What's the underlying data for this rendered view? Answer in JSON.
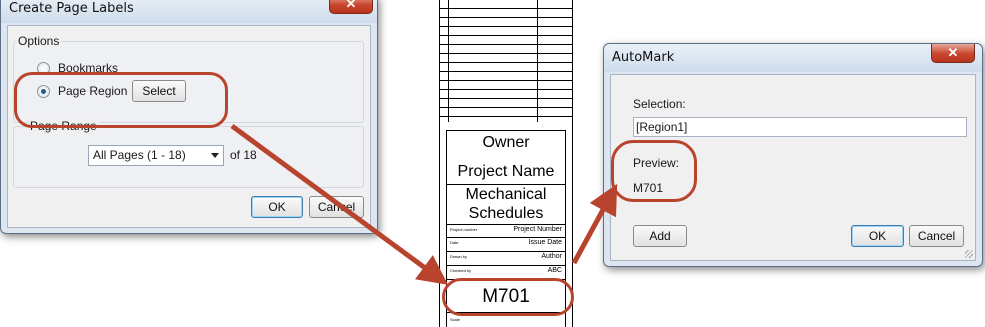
{
  "create_page_labels": {
    "title": "Create Page Labels",
    "close_symbol": "✕",
    "options_group_label": "Options",
    "bookmarks_label": "Bookmarks",
    "page_region_label": "Page Region",
    "select_button": "Select",
    "page_range_group_label": "Page Range",
    "page_range_value": "All Pages (1 - 18)",
    "page_range_suffix": "of 18",
    "ok_button": "OK",
    "cancel_button": "Cancel"
  },
  "title_block": {
    "owner": "Owner",
    "project_name": "Project Name",
    "sheet_title_line1": "Mechanical",
    "sheet_title_line2": "Schedules",
    "project_number_caption": "Project number",
    "project_number_value": "Project Number",
    "date_caption": "Date",
    "date_value": "Issue Date",
    "drawn_by_caption": "Drawn by",
    "drawn_by_value": "Author",
    "checked_by_caption": "Checked by",
    "checked_by_value": "ABC",
    "sheet_number": "M701",
    "scale_caption": "Scale"
  },
  "automark": {
    "title": "AutoMark",
    "close_symbol": "✕",
    "selection_label": "Selection:",
    "selection_value": "[Region1]",
    "preview_label": "Preview:",
    "preview_value": "M701",
    "add_button": "Add",
    "ok_button": "OK",
    "cancel_button": "Cancel"
  },
  "colors": {
    "annotation_red": "#b8442e",
    "window_frame": "#dde6f0",
    "close_button": "#c9452e"
  }
}
